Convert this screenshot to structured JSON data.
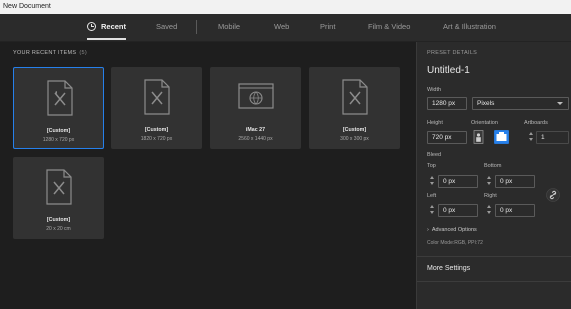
{
  "window": {
    "title": "New Document"
  },
  "tabs": [
    {
      "label": "Recent"
    },
    {
      "label": "Saved"
    },
    {
      "label": "Mobile"
    },
    {
      "label": "Web"
    },
    {
      "label": "Print"
    },
    {
      "label": "Film & Video"
    },
    {
      "label": "Art & Illustration"
    }
  ],
  "recent": {
    "heading": "YOUR RECENT ITEMS",
    "count": "(5)",
    "items": [
      {
        "name": "[Custom]",
        "dims": "1280 x 720 px",
        "icon": "document-icon"
      },
      {
        "name": "[Custom]",
        "dims": "1820 x 720 px",
        "icon": "document-icon"
      },
      {
        "name": "iMac 27",
        "dims": "2560 x 1440 px",
        "icon": "web-screen-icon"
      },
      {
        "name": "[Custom]",
        "dims": "300 x 300 px",
        "icon": "document-icon"
      },
      {
        "name": "[Custom]",
        "dims": "20 x 20 cm",
        "icon": "document-icon"
      }
    ]
  },
  "preset": {
    "heading": "PRESET DETAILS",
    "title": "Untitled-1",
    "width_label": "Width",
    "width_value": "1280 px",
    "units": "Pixels",
    "height_label": "Height",
    "height_value": "720 px",
    "orientation_label": "Orientation",
    "artboards_label": "Artboards",
    "artboards_value": "1",
    "bleed_label": "Bleed",
    "top_label": "Top",
    "top_value": "0 px",
    "bottom_label": "Bottom",
    "bottom_value": "0 px",
    "left_label": "Left",
    "left_value": "0 px",
    "right_label": "Right",
    "right_value": "0 px",
    "advanced": "Advanced Options",
    "color_mode": "Color Mode:RGB, PPI:72",
    "more_settings": "More Settings"
  },
  "colors": {
    "accent": "#2680eb",
    "background": "#1e1e1e",
    "panel": "#2b2b2b",
    "card": "#323232"
  }
}
